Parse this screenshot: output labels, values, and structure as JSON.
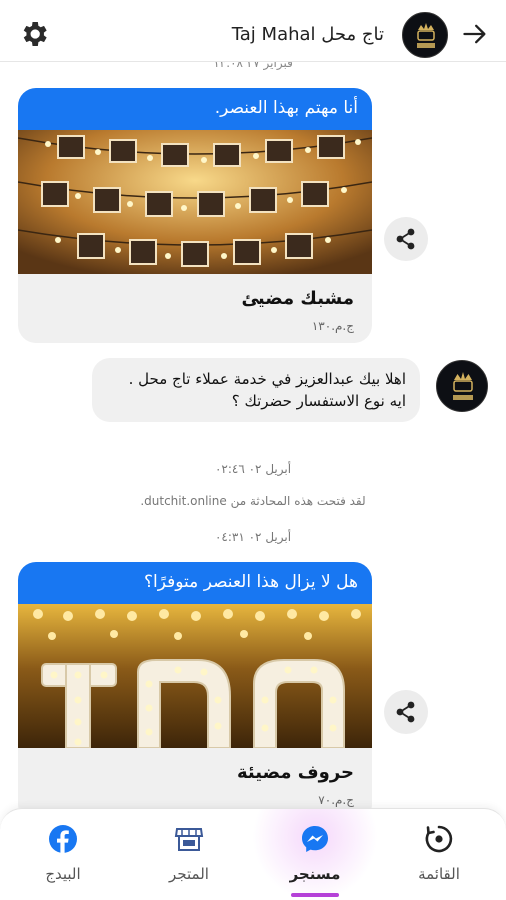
{
  "header": {
    "title": "تاج محل Taj Mahal",
    "back_icon": "arrow-right-icon",
    "settings_icon": "gear-icon"
  },
  "messages": {
    "top_timestamp": "فبراير ٢٧ ١٣:٠٨",
    "card1": {
      "header": "أنا مهتم بهذا العنصر.",
      "name": "مشبك مضيئ",
      "price": "ج.م.١٣٠"
    },
    "bot_message": "اهلا بيك عبدالعزيز في خدمة عملاء تاج محل .\nايه نوع الاستفسار حضرتك ؟",
    "bot_timestamp": "أبريل ٠٢ ٠٢:٤٦",
    "opened_notice": "لقد فتحت هذه المحادثة من dutchit.online.",
    "card2_timestamp": "أبريل ٠٢ ٠٤:٣١",
    "card2": {
      "header": "هل لا يزال هذا العنصر متوفرًا؟",
      "name": "حروف مضيئة",
      "price": "ج.م.٧٠"
    }
  },
  "nav": {
    "items": [
      {
        "label": "القائمة",
        "icon": "menu-circle-icon",
        "active": false
      },
      {
        "label": "مسنجر",
        "icon": "messenger-icon",
        "active": true
      },
      {
        "label": "المتجر",
        "icon": "store-icon",
        "active": false
      },
      {
        "label": "البيدج",
        "icon": "facebook-icon",
        "active": false
      }
    ]
  },
  "colors": {
    "accent": "#1877f2",
    "active_tab": "#b541d8",
    "bubble_bg": "#f0f0f0"
  }
}
